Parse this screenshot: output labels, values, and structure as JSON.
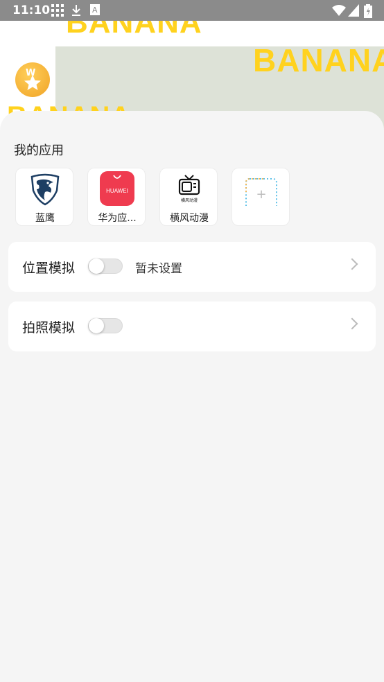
{
  "status_bar": {
    "time": "11:10",
    "icons": [
      "grid-icon",
      "download-icon",
      "app-a-icon",
      "wifi-icon",
      "signal-icon",
      "battery-icon"
    ]
  },
  "banner": {
    "text_top": "BANANA",
    "text_right": "BANANA",
    "text_left": "BANANA"
  },
  "my_apps": {
    "title": "我的应用",
    "items": [
      {
        "label": "蓝鹰",
        "icon": "eagle-icon"
      },
      {
        "label": "华为应...",
        "icon": "huawei-appgallery-icon",
        "icon_text": "HUAWEI"
      },
      {
        "label": "横风动漫",
        "icon": "tv-icon",
        "icon_text": "横风动漫"
      },
      {
        "label": "",
        "icon": "add-app-icon",
        "symbol": "+"
      }
    ]
  },
  "settings": [
    {
      "title": "位置模拟",
      "toggle_on": false,
      "status": "暂未设置"
    },
    {
      "title": "拍照模拟",
      "toggle_on": false,
      "status": ""
    }
  ],
  "colors": {
    "accent_yellow": "#ffd21e",
    "huawei_red": "#ef3b4f",
    "background": "#f5f5f5"
  }
}
